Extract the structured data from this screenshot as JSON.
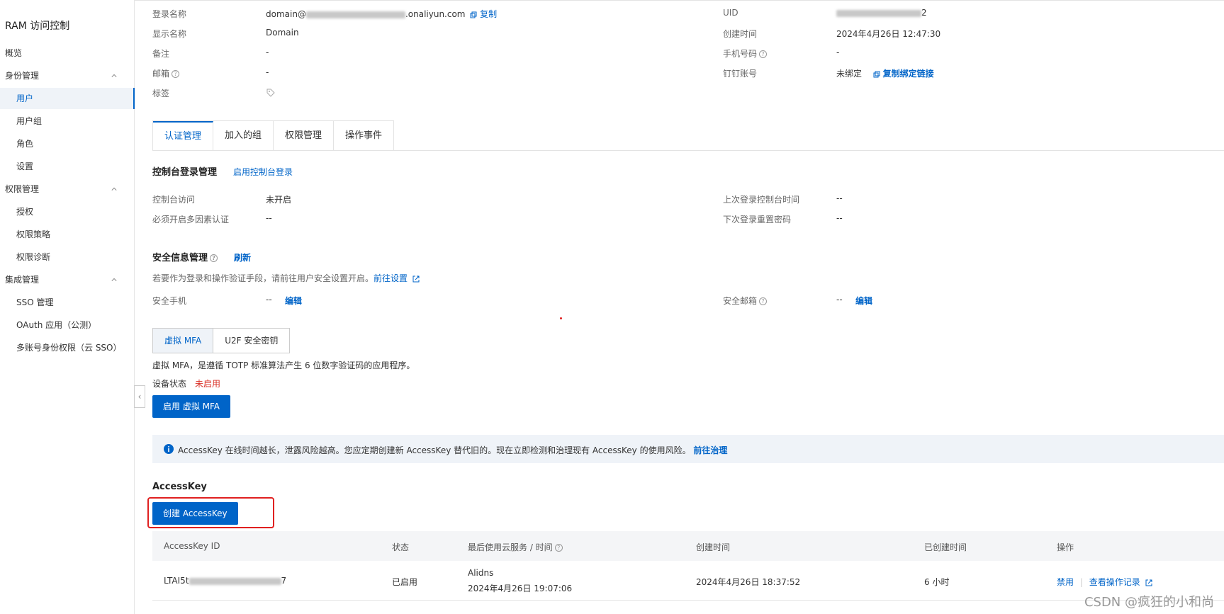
{
  "sidebar": {
    "title": "RAM 访问控制",
    "items": [
      {
        "label": "概览"
      },
      {
        "label": "身份管理"
      },
      {
        "label": "用户"
      },
      {
        "label": "用户组"
      },
      {
        "label": "角色"
      },
      {
        "label": "设置"
      },
      {
        "label": "权限管理"
      },
      {
        "label": "授权"
      },
      {
        "label": "权限策略"
      },
      {
        "label": "权限诊断"
      },
      {
        "label": "集成管理"
      },
      {
        "label": "SSO 管理"
      },
      {
        "label": "OAuth 应用（公测）"
      },
      {
        "label": "多账号身份权限（云 SSO）"
      }
    ]
  },
  "info": {
    "login_name_label": "登录名称",
    "login_name_prefix": "domain@",
    "login_name_suffix": ".onaliyun.com",
    "copy": "复制",
    "display_name_label": "显示名称",
    "display_name": "Domain",
    "remark_label": "备注",
    "remark": "-",
    "email_label": "邮箱",
    "email": "-",
    "tags_label": "标签",
    "uid_label": "UID",
    "uid_tail": "2",
    "created_label": "创建时间",
    "created": "2024年4月26日 12:47:30",
    "phone_label": "手机号码",
    "phone": "-",
    "dingtalk_label": "钉钉账号",
    "dingtalk": "未绑定",
    "copy_bind_link": "复制绑定链接"
  },
  "tabs": [
    "认证管理",
    "加入的组",
    "权限管理",
    "操作事件"
  ],
  "console": {
    "title": "控制台登录管理",
    "enable_link": "启用控制台登录",
    "access_label": "控制台访问",
    "access": "未开启",
    "mfa_label": "必须开启多因素认证",
    "mfa": "--",
    "last_login_label": "上次登录控制台时间",
    "last_login": "--",
    "reset_pwd_label": "下次登录重置密码",
    "reset_pwd": "--"
  },
  "security": {
    "title": "安全信息管理",
    "refresh": "刷新",
    "hint": "若要作为登录和操作验证手段，请前往用户安全设置开启。",
    "goto_settings": "前往设置",
    "phone_label": "安全手机",
    "phone": "--",
    "edit": "编辑",
    "email_label": "安全邮箱",
    "email": "--"
  },
  "mfa": {
    "seg_virtual": "虚拟 MFA",
    "seg_u2f": "U2F 安全密钥",
    "desc": "虚拟 MFA，是遵循 TOTP 标准算法产生 6 位数字验证码的应用程序。",
    "status_label": "设备状态",
    "status": "未启用",
    "enable_button": "启用 虚拟 MFA"
  },
  "notice": {
    "text": "AccessKey 在线时间越长，泄露风险越高。您应定期创建新 AccessKey 替代旧的。现在立即检测和治理现有 AccessKey 的使用风险。",
    "link": "前往治理"
  },
  "accesskey": {
    "title": "AccessKey",
    "create_button": "创建 AccessKey",
    "columns": [
      "AccessKey ID",
      "状态",
      "最后使用云服务 / 时间",
      "创建时间",
      "已创建时间",
      "操作"
    ],
    "rows": [
      {
        "id_prefix": "LTAI5t",
        "id_suffix": "7",
        "status": "已启用",
        "last_service": "Alidns",
        "last_time": "2024年4月26日 19:07:06",
        "created": "2024年4月26日 18:37:52",
        "age": "6 小时",
        "disable": "禁用",
        "view_log": "查看操作记录"
      }
    ]
  },
  "watermark": "CSDN @疯狂的小和尚",
  "colors": {
    "accent": "#0064c8",
    "danger": "#d93026",
    "brand": "#ff6a00"
  }
}
